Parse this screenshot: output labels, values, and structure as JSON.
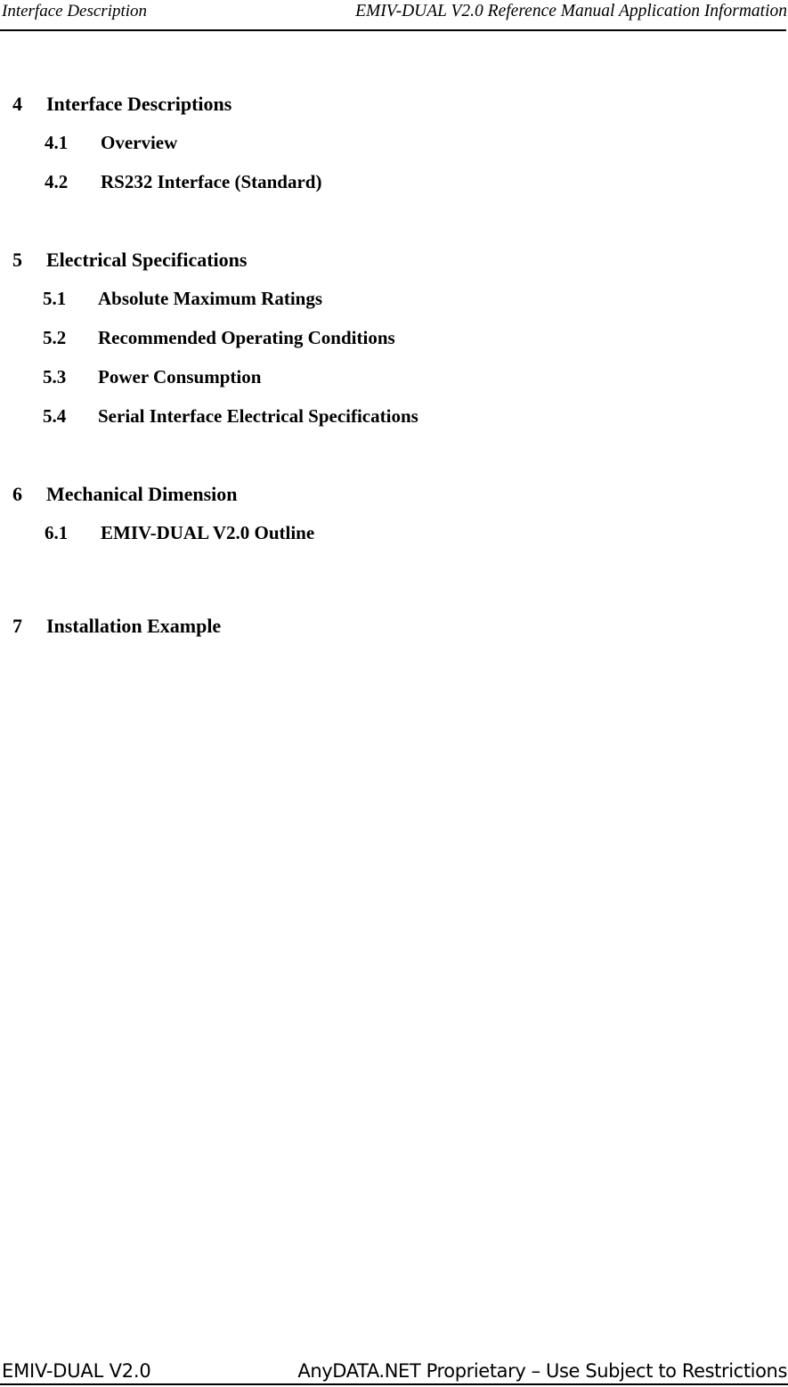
{
  "header": {
    "left_text": "Interface Description",
    "right_text": "EMIV-DUAL V2.0 Reference Manual Application Information"
  },
  "toc": {
    "entries": [
      {
        "number": "4",
        "label": "Interface Descriptions",
        "level": 1
      },
      {
        "number": "4.1",
        "label": "Overview",
        "level": 2
      },
      {
        "number": "4.2",
        "label": "RS232 Interface (Standard)",
        "level": 2
      },
      {
        "number": "5",
        "label": "Electrical Specifications",
        "level": 1
      },
      {
        "number": "5.1",
        "label": "Absolute Maximum Ratings",
        "level": 2
      },
      {
        "number": "5.2",
        "label": "Recommended Operating Conditions",
        "level": 2
      },
      {
        "number": "5.3",
        "label": "Power Consumption",
        "level": 2
      },
      {
        "number": "5.4",
        "label": "Serial Interface Electrical Specifications",
        "level": 2
      },
      {
        "number": "6",
        "label": "Mechanical Dimension",
        "level": 1
      },
      {
        "number": "6.1",
        "label": "EMIV-DUAL V2.0 Outline",
        "level": 2
      },
      {
        "number": "7",
        "label": "Installation Example",
        "level": 1
      }
    ]
  },
  "footer": {
    "left_text": "EMIV-DUAL V2.0",
    "right_text": "AnyDATA.NET Proprietary – Use Subject to Restrictions"
  }
}
